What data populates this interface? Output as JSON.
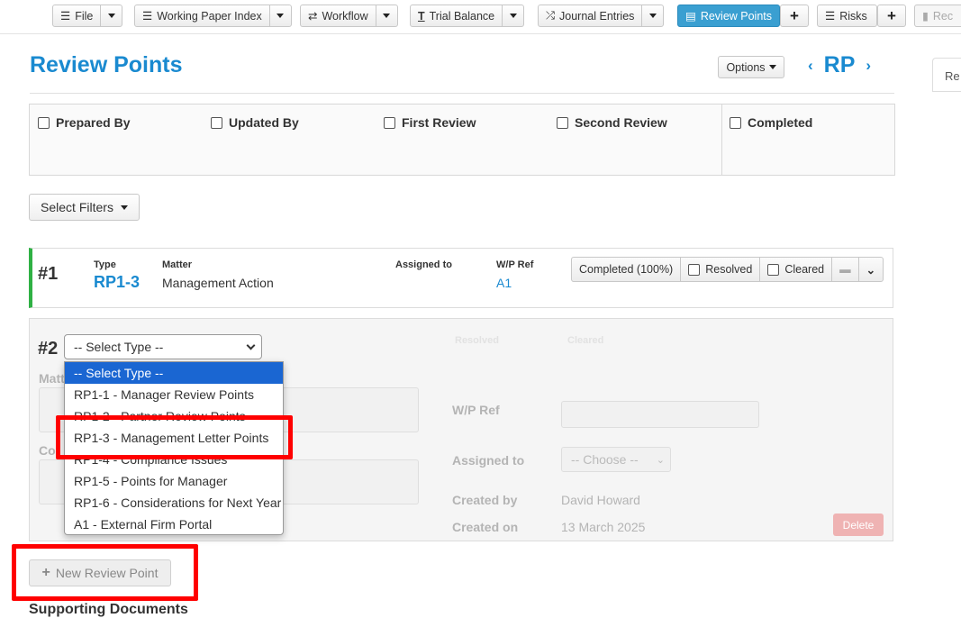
{
  "toolbar": {
    "file": "File",
    "working_paper_index": "Working Paper Index",
    "workflow": "Workflow",
    "trial_balance": "Trial Balance",
    "journal_entries": "Journal Entries",
    "review_points": "Review Points",
    "risks": "Risks",
    "rec": "Rec",
    "plus": "+"
  },
  "header": {
    "title": "Review Points",
    "options_label": "Options",
    "rp_code": "RP",
    "right_tab": "Re"
  },
  "filters": {
    "prepared_by": "Prepared By",
    "updated_by": "Updated By",
    "first_review": "First Review",
    "second_review": "Second Review",
    "completed": "Completed",
    "select_filters": "Select Filters"
  },
  "review_point_1": {
    "number": "#1",
    "type_label": "Type",
    "type_value": "RP1-3",
    "matter_label": "Matter",
    "matter_value": "Management Action",
    "assigned_label": "Assigned to",
    "wp_ref_label": "W/P Ref",
    "wp_ref_value": "A1",
    "status": "Completed (100%)",
    "resolved": "Resolved",
    "cleared": "Cleared"
  },
  "review_point_2": {
    "number": "#2",
    "select_type_value": "-- Select Type --",
    "matter_label_partial": "Matt",
    "comment_label_partial": "Co",
    "wp_ref_label": "W/P Ref",
    "assigned_label": "Assigned to",
    "assigned_placeholder": "-- Choose --",
    "created_by_label": "Created by",
    "created_by_value": "David Howard",
    "created_on_label": "Created on",
    "created_on_value": "13 March 2025",
    "delete_label": "Delete",
    "ghost_1": "Resolved",
    "ghost_2": "Cleared"
  },
  "type_options": [
    "-- Select Type --",
    "RP1-1 - Manager Review Points",
    "RP1-2 - Partner Review Points",
    "RP1-3 - Management Letter Points",
    "RP1-4 - Compliance Issues",
    "RP1-5 - Points for Manager",
    "RP1-6 - Considerations for Next Year",
    "A1 - External Firm Portal"
  ],
  "new_review_point": "New Review Point",
  "bottom_heading": "Supporting Documents",
  "colors": {
    "accent": "#1a8ad0",
    "active_tab": "#3a9fd1",
    "selected_option": "#1a66d2",
    "highlight": "#ff0000",
    "completed_bar": "#2fb144"
  }
}
